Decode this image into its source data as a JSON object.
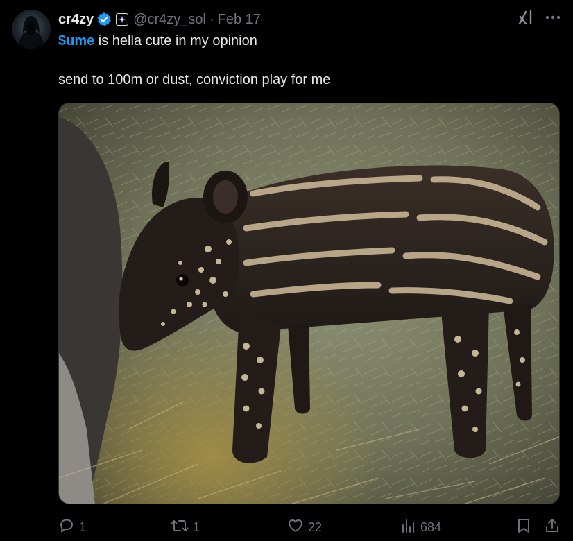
{
  "author": {
    "display_name": "cr4zy",
    "handle": "@cr4zy_sol",
    "date": "Feb 17",
    "separator": "·"
  },
  "post": {
    "cashtag": "$ume",
    "line1_rest": " is hella cute in my opinion",
    "line2": "send to 100m or dust, conviction play for me"
  },
  "media": {
    "subject": "baby tapir standing on hay next to adult tapir"
  },
  "actions": {
    "replies": "1",
    "reposts": "1",
    "likes": "22",
    "views": "684"
  },
  "colors": {
    "background": "#000000",
    "text": "#e7e9ea",
    "secondary": "#71767b",
    "accent": "#1d9bf0",
    "border": "#2f3336"
  },
  "icons": {
    "verified": "verified-badge-icon",
    "affiliate": "affiliate-badge-icon",
    "grok": "grok-icon",
    "more": "more-icon",
    "reply": "reply-icon",
    "repost": "repost-icon",
    "like": "heart-icon",
    "views": "views-icon",
    "bookmark": "bookmark-icon",
    "share": "share-icon"
  }
}
